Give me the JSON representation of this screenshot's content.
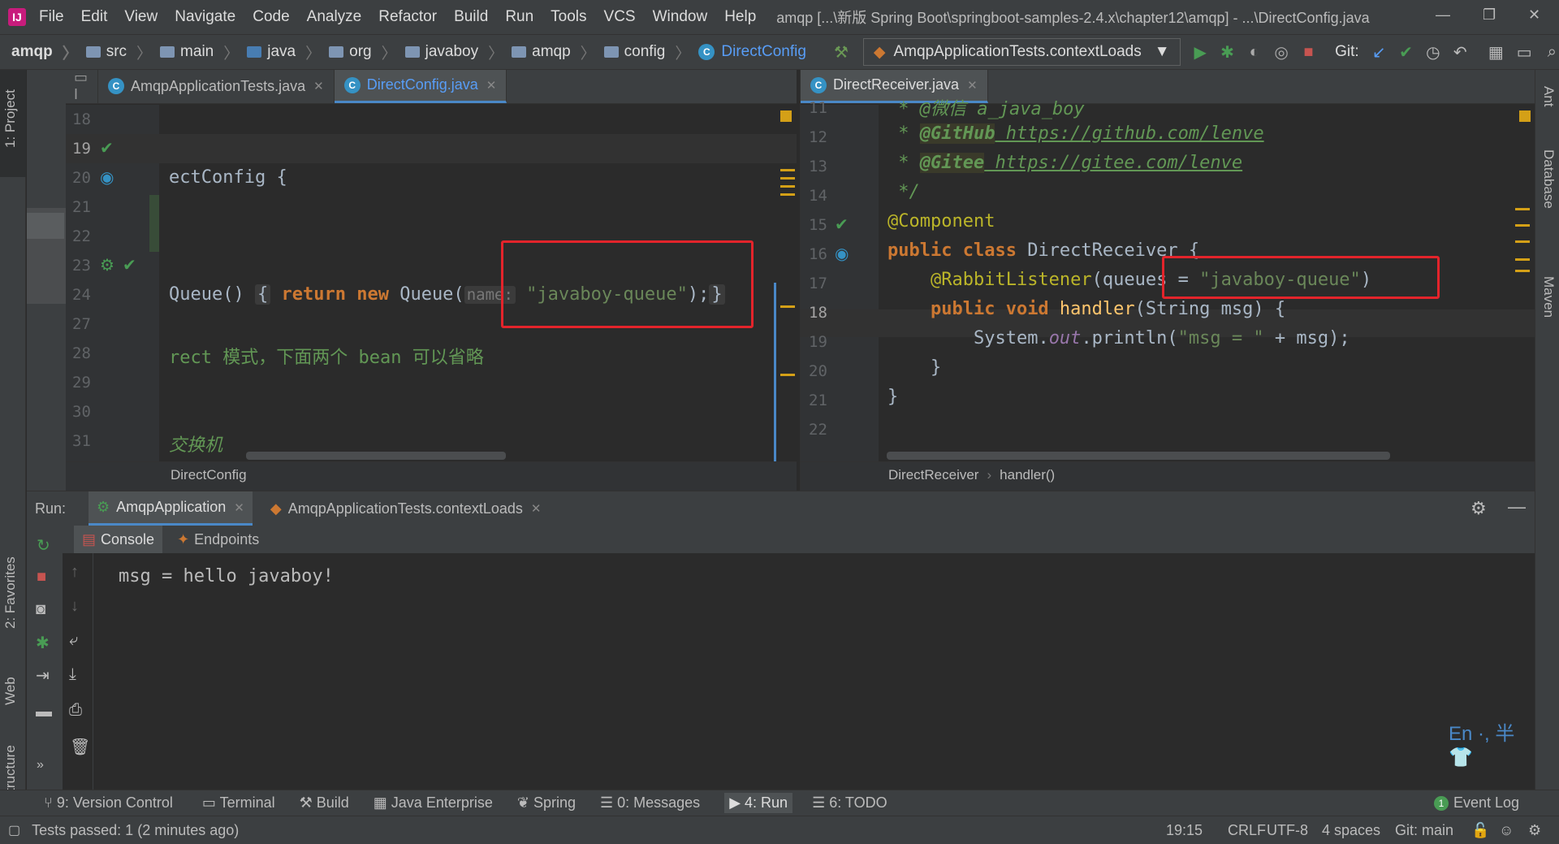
{
  "menu": {
    "items": [
      "File",
      "Edit",
      "View",
      "Navigate",
      "Code",
      "Analyze",
      "Refactor",
      "Build",
      "Run",
      "Tools",
      "VCS",
      "Window",
      "Help"
    ],
    "title": "amqp [...\\新版 Spring Boot\\springboot-samples-2.4.x\\chapter12\\amqp] - ...\\DirectConfig.java"
  },
  "breadcrumb": [
    "amqp",
    "src",
    "main",
    "java",
    "org",
    "javaboy",
    "amqp",
    "config",
    "DirectConfig"
  ],
  "run_config": "AmqpApplicationTests.contextLoads",
  "git_label": "Git:",
  "left_strip": {
    "project": "1: Project",
    "favorites": "2: Favorites",
    "web": "Web",
    "structure": "Z: Structure"
  },
  "right_strip": {
    "ant": "Ant",
    "database": "Database",
    "maven": "Maven"
  },
  "left_editor": {
    "tabs": [
      {
        "label": "AmqpApplicationTests.java",
        "active": false
      },
      {
        "label": "DirectConfig.java",
        "active": true
      }
    ],
    "line_numbers": [
      "18",
      "19",
      "20",
      "21",
      "22",
      "23",
      "24",
      "27",
      "28",
      "29",
      "30",
      "31"
    ],
    "line20": "ectConfig {",
    "line24_a": "Queue()",
    "line24_b": "{",
    "line24_return": "return",
    "line24_new": "new",
    "line24_queue": "Queue(",
    "line24_hint": "name:",
    "line24_str": "\"javaboy-queue\"",
    "line24_end": ");",
    "line24_brace": "}",
    "line28": "rect 模式，下面两个 bean 可以省略",
    "line31": "交换机",
    "breadcrumb": "DirectConfig"
  },
  "right_editor": {
    "tabs": [
      {
        "label": "DirectReceiver.java",
        "active": true
      }
    ],
    "line_numbers": [
      "11",
      "12",
      "13",
      "14",
      "15",
      "16",
      "17",
      "18",
      "19",
      "20",
      "21",
      "22"
    ],
    "l11": " * @微信 a_java_boy",
    "l12_a": " * ",
    "l12_tag": "@GitHub",
    "l12_url": " https://github.com/lenve",
    "l13_a": " * ",
    "l13_tag": "@Gitee",
    "l13_url": " https://gitee.com/lenve",
    "l14": " */",
    "l15": "@Component",
    "l16_kw": "public class",
    "l16_name": " DirectReceiver {",
    "l17_ann": "@RabbitListener",
    "l17_mid": "(queues = ",
    "l17_str": "\"javaboy-queue\"",
    "l17_end": ")",
    "l18_kw": "public void",
    "l18_fn": " handler",
    "l18_rest": "(String msg) {",
    "l19_a": "System.",
    "l19_out": "out",
    "l19_b": ".println(",
    "l19_str": "\"msg = \"",
    "l19_c": " + msg);",
    "l20": "}",
    "l21": "}",
    "breadcrumb_class": "DirectReceiver",
    "breadcrumb_method": "handler()"
  },
  "run_panel": {
    "label": "Run:",
    "tabs": [
      "AmqpApplication",
      "AmqpApplicationTests.contextLoads"
    ],
    "subtabs": [
      "Console",
      "Endpoints"
    ],
    "output": "msg = hello javaboy!"
  },
  "ime": "En ·, 半",
  "bottom_tabs": [
    "9: Version Control",
    "Terminal",
    "Build",
    "Java Enterprise",
    "Spring",
    "0: Messages",
    "4: Run",
    "6: TODO"
  ],
  "event_log": "Event Log",
  "event_count": "1",
  "status": {
    "message": "Tests passed: 1 (2 minutes ago)",
    "position": "19:15",
    "line_sep": "CRLF",
    "encoding": "UTF-8",
    "indent": "4 spaces",
    "git": "Git: main"
  },
  "colors": {
    "accent_red": "#e3242b",
    "active_tab": "#589df6",
    "keyword": "#cc7832",
    "string": "#6a8759",
    "annotation": "#bbb529"
  }
}
